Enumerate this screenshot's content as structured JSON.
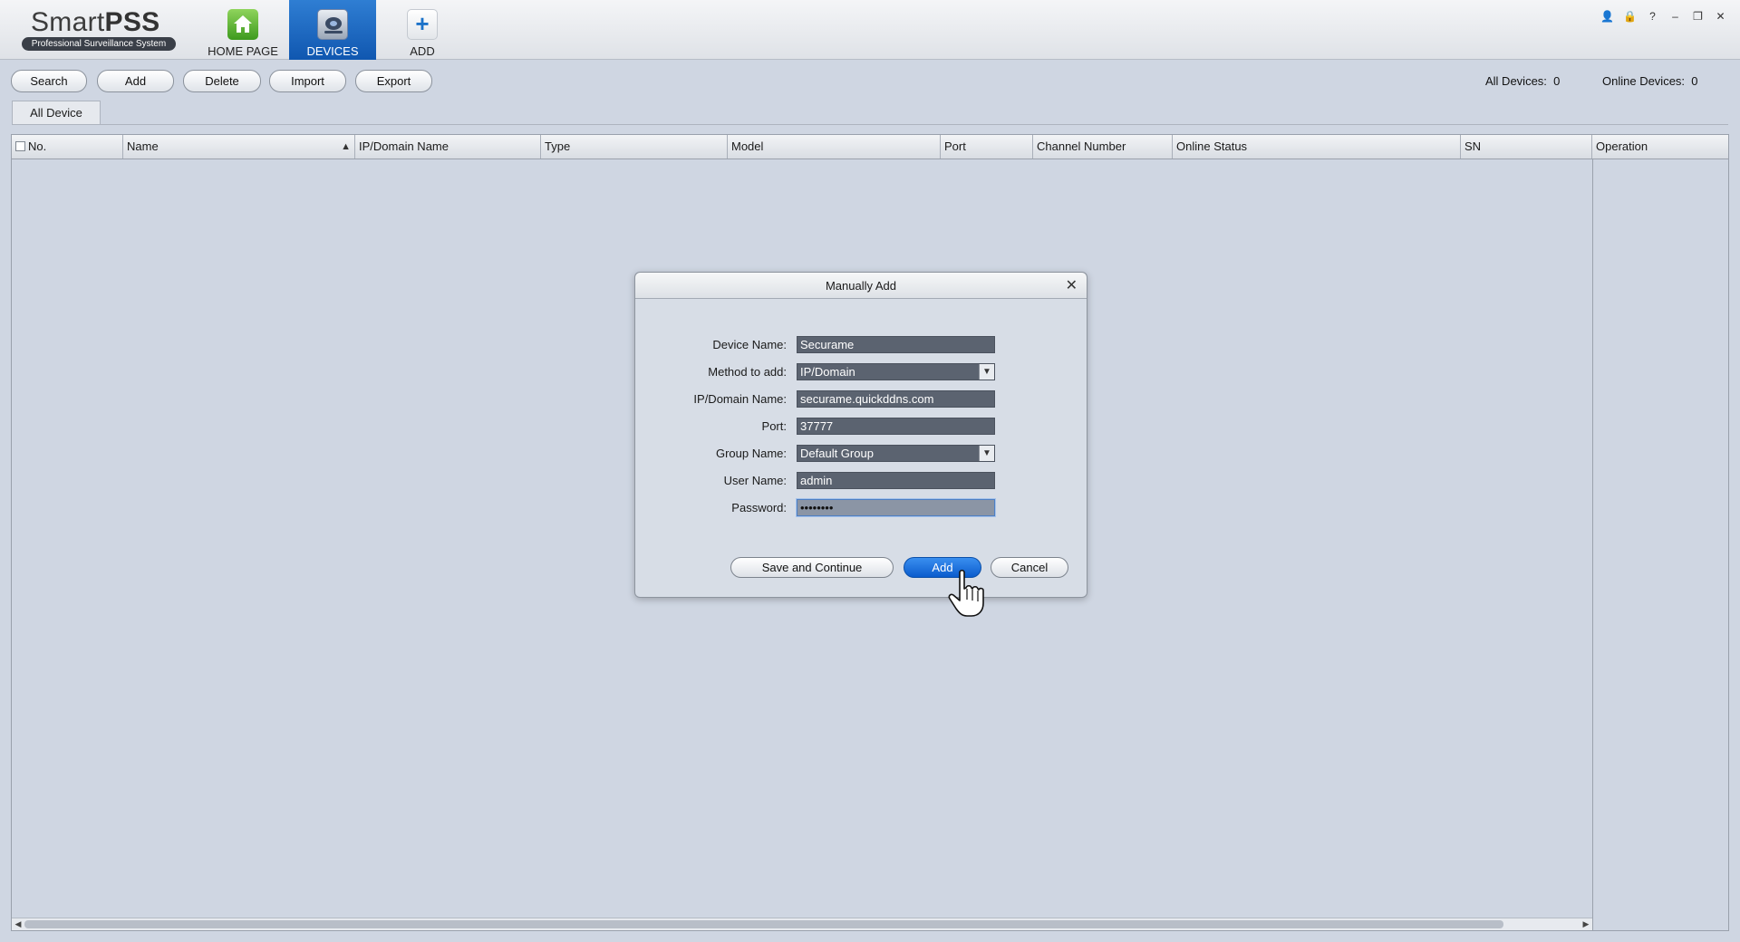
{
  "app": {
    "logo_name": "Smart",
    "logo_bold": "PSS",
    "logo_subtitle": "Professional Surveillance System"
  },
  "nav": {
    "home": {
      "label": "HOME PAGE",
      "icon": "house-icon"
    },
    "devices": {
      "label": "DEVICES",
      "icon": "camera-icon",
      "active": true
    },
    "add": {
      "label": "ADD",
      "icon": "plus-icon",
      "glyph": "+"
    }
  },
  "window_controls": [
    {
      "icon": "user-icon",
      "glyph": "👤"
    },
    {
      "icon": "lock-icon",
      "glyph": "🔒"
    },
    {
      "icon": "help-icon",
      "glyph": "?"
    },
    {
      "icon": "minimize-icon",
      "glyph": "–"
    },
    {
      "icon": "restore-icon",
      "glyph": "❐"
    },
    {
      "icon": "close-icon",
      "glyph": "✕"
    }
  ],
  "toolbar": {
    "search": "Search",
    "add": "Add",
    "delete": "Delete",
    "import": "Import",
    "export": "Export",
    "all_devices_label": "All Devices:",
    "all_devices_count": "0",
    "online_devices_label": "Online Devices:",
    "online_devices_count": "0"
  },
  "tabs": {
    "all_device": "All Device"
  },
  "table": {
    "columns": {
      "no": "No.",
      "name": "Name",
      "ip": "IP/Domain Name",
      "type": "Type",
      "model": "Model",
      "port": "Port",
      "channel": "Channel Number",
      "status": "Online Status",
      "sn": "SN",
      "operation": "Operation"
    },
    "sort_glyph": "▲",
    "scroll_left": "◀",
    "scroll_right": "▶"
  },
  "dialog": {
    "title": "Manually Add",
    "close_glyph": "✕",
    "fields": {
      "device_name": {
        "label": "Device Name:",
        "value": "Securame"
      },
      "method": {
        "label": "Method to add:",
        "value": "IP/Domain"
      },
      "ip_domain": {
        "label": "IP/Domain Name:",
        "value": "securame.quickddns.com"
      },
      "port": {
        "label": "Port:",
        "value": "37777"
      },
      "group": {
        "label": "Group Name:",
        "value": "Default Group"
      },
      "user": {
        "label": "User Name:",
        "value": "admin"
      },
      "password": {
        "label": "Password:",
        "value": "••••••••"
      }
    },
    "dropdown_glyph": "▼",
    "buttons": {
      "save_continue": "Save and Continue",
      "add": "Add",
      "cancel": "Cancel"
    }
  }
}
